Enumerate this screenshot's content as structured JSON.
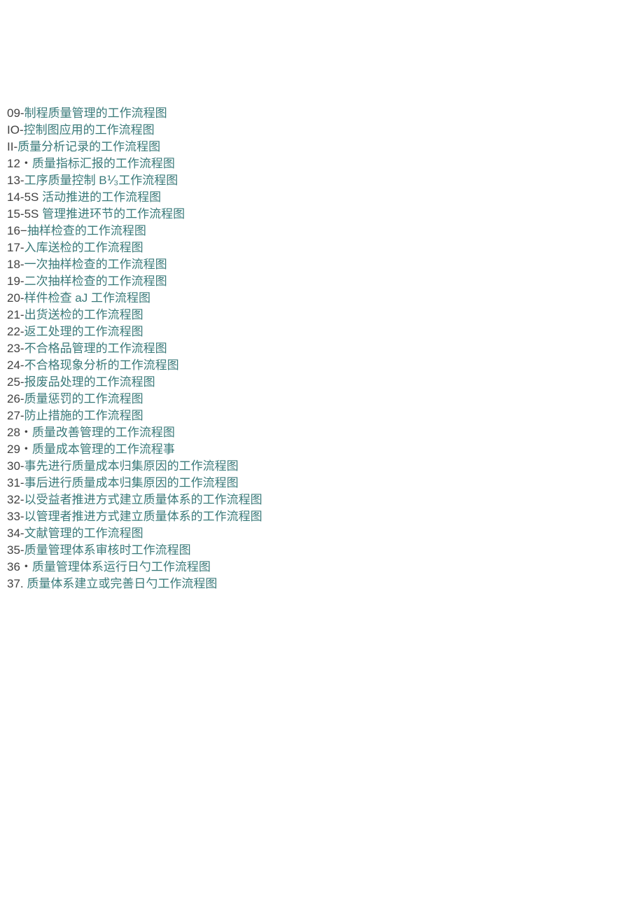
{
  "lines": [
    {
      "num": "09-",
      "text": "制程质量管理的工作流程图",
      "numColor": "#424242",
      "textColor": "#3a7a7a"
    },
    {
      "num": "IO-",
      "text": "控制图应用的工作流程图",
      "numColor": "#424242",
      "textColor": "#3a7a7a"
    },
    {
      "num": "II-",
      "text": "质量分析记录的工作流程图",
      "numColor": "#424242",
      "textColor": "#3a7a7a"
    },
    {
      "num": "12・",
      "text": "质量指标汇报的工作流程图",
      "numColor": "#424242",
      "textColor": "#3a7a7a"
    },
    {
      "num": "13-",
      "text": "工序质量控制 B⅟₃工作流程图",
      "numColor": "#424242",
      "textColor": "#3a7a7a"
    },
    {
      "num": "14-5S ",
      "text": "活动推进的工作流程图",
      "numColor": "#424242",
      "textColor": "#3a7a7a"
    },
    {
      "num": "15-5S ",
      "text": "管理推进环节的工作流程图",
      "numColor": "#424242",
      "textColor": "#3a7a7a"
    },
    {
      "num": "16−",
      "text": "抽样检查的工作流程图",
      "numColor": "#424242",
      "textColor": "#3a7a7a"
    },
    {
      "num": "17-",
      "text": "入库送检的工作流程图",
      "numColor": "#424242",
      "textColor": "#3a7a7a"
    },
    {
      "num": "18-",
      "text": "一次抽样检查的工作流程图",
      "numColor": "#424242",
      "textColor": "#3a7a7a"
    },
    {
      "num": "19-",
      "text": "二次抽样检查的工作流程图",
      "numColor": "#424242",
      "textColor": "#3a7a7a"
    },
    {
      "num": "20-",
      "text": "样件检查 aJ 工作流程图",
      "numColor": "#424242",
      "textColor": "#3a7a7a"
    },
    {
      "num": "21-",
      "text": "出货送检的工作流程图",
      "numColor": "#424242",
      "textColor": "#3a7a7a"
    },
    {
      "num": "22-",
      "text": "返工处理的工作流程图",
      "numColor": "#424242",
      "textColor": "#3a7a7a"
    },
    {
      "num": "23-",
      "text": "不合格品管理的工作流程图",
      "numColor": "#424242",
      "textColor": "#3a7a7a"
    },
    {
      "num": "24-",
      "text": "不合格现象分析的工作流程图",
      "numColor": "#424242",
      "textColor": "#3a7a7a"
    },
    {
      "num": "25-",
      "text": "报废品处理的工作流程图",
      "numColor": "#424242",
      "textColor": "#3a7a7a"
    },
    {
      "num": "26-",
      "text": "质量惩罚的工作流程图",
      "numColor": "#424242",
      "textColor": "#3a7a7a"
    },
    {
      "num": "27-",
      "text": "防止措施的工作流程图",
      "numColor": "#424242",
      "textColor": "#3a7a7a"
    },
    {
      "num": "28・",
      "text": "质量改善管理的工作流程图",
      "numColor": "#424242",
      "textColor": "#3a7a7a"
    },
    {
      "num": "29・",
      "text": "质量成本管理的工作流程事",
      "numColor": "#424242",
      "textColor": "#3a7a7a"
    },
    {
      "num": "30-",
      "text": "事先进行质量成本归集原因的工作流程图",
      "numColor": "#424242",
      "textColor": "#3a7a7a"
    },
    {
      "num": "31-",
      "text": "事后进行质量成本归集原因的工作流程图",
      "numColor": "#424242",
      "textColor": "#3a7a7a"
    },
    {
      "num": "32-",
      "text": "以受益者推进方式建立质量体系的工作流程图",
      "numColor": "#424242",
      "textColor": "#3a7a7a"
    },
    {
      "num": "33-",
      "text": "以管理者推进方式建立质量体系的工作流程图",
      "numColor": "#424242",
      "textColor": "#3a7a7a"
    },
    {
      "num": "34-",
      "text": "文献管理的工作流程图",
      "numColor": "#424242",
      "textColor": "#3a7a7a"
    },
    {
      "num": "35-",
      "text": "质量管理体系审核时工作流程图",
      "numColor": "#424242",
      "textColor": "#3a7a7a"
    },
    {
      "num": "36・",
      "text": "质量管理体系运行日勺工作流程图",
      "numColor": "#424242",
      "textColor": "#3a7a7a"
    },
    {
      "num": "37. ",
      "text": "质量体系建立或完善日勺工作流程图",
      "numColor": "#424242",
      "textColor": "#3a7a7a"
    }
  ]
}
